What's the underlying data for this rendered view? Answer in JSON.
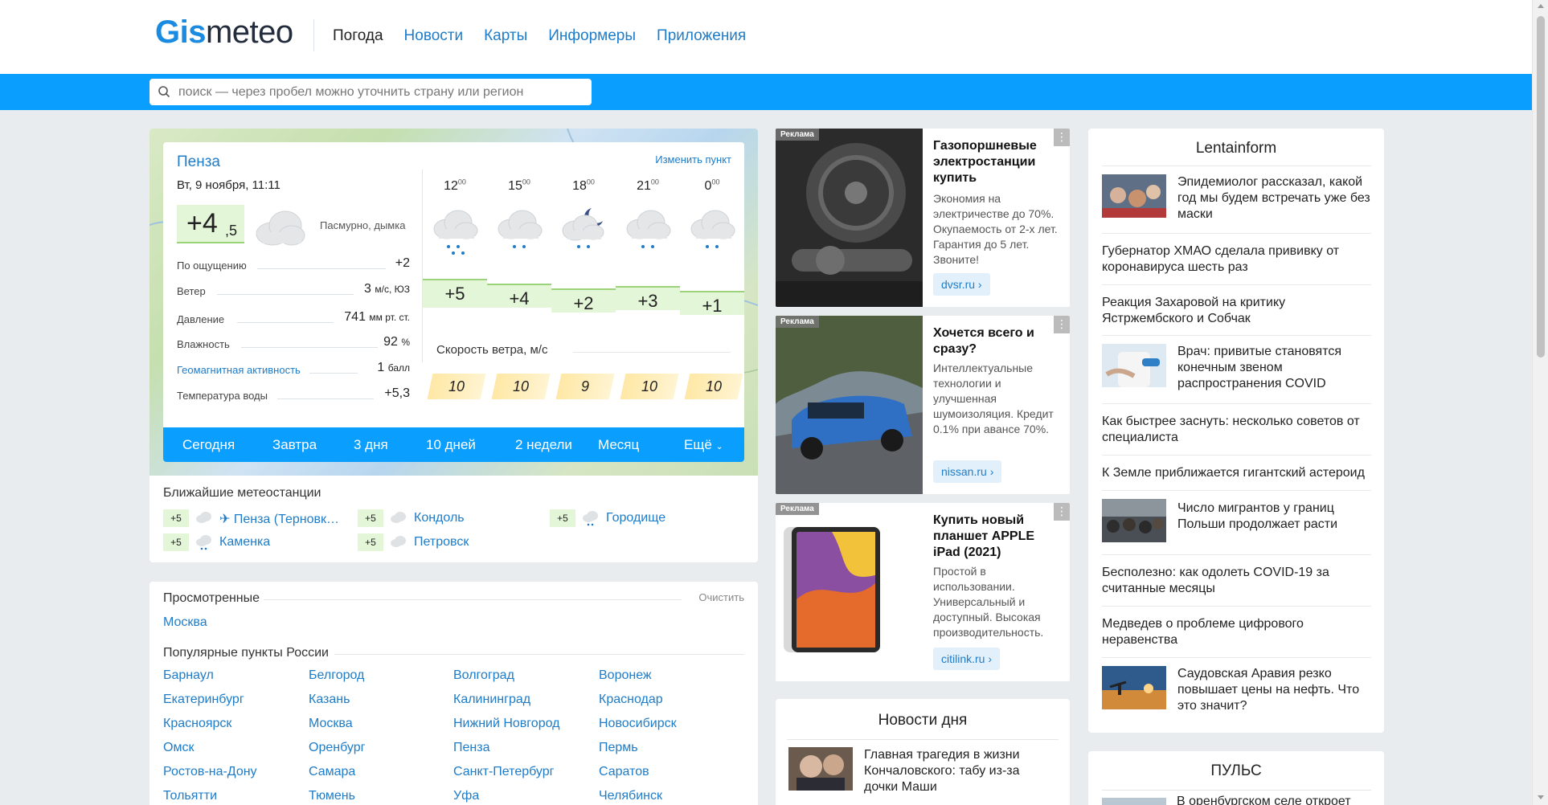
{
  "header": {
    "logo_gis": "Gis",
    "logo_meteo": "meteo",
    "nav": [
      {
        "label": "Погода",
        "active": true
      },
      {
        "label": "Новости",
        "active": false
      },
      {
        "label": "Карты",
        "active": false
      },
      {
        "label": "Информеры",
        "active": false
      },
      {
        "label": "Приложения",
        "active": false
      }
    ]
  },
  "search": {
    "placeholder": "поиск — через пробел можно уточнить страну или регион",
    "value": ""
  },
  "weather": {
    "city": "Пенза",
    "change_point": "Изменить пункт",
    "date": "Вт, 9 ноября, 11:11",
    "now_temp_main": "+4",
    "now_temp_decimal": ",5",
    "now_desc": "Пасмурно, дымка",
    "params": [
      {
        "label": "По ощущению",
        "value": "+2",
        "unit": "",
        "link": false
      },
      {
        "label": "Ветер",
        "value": "3",
        "unit": "м/с, ЮЗ",
        "link": false
      },
      {
        "label": "Давление",
        "value": "741",
        "unit": "мм рт. ст.",
        "link": false
      },
      {
        "label": "Влажность",
        "value": "92",
        "unit": "%",
        "link": false
      },
      {
        "label": "Геомагнитная активность",
        "value": "1",
        "unit": "балл",
        "link": true
      },
      {
        "label": "Температура воды",
        "value": "+5,3",
        "unit": "",
        "link": false
      }
    ],
    "forecast": [
      {
        "hour": "12",
        "min": "00",
        "temp": "+5",
        "wind": "10",
        "icon": "cloud-rain-icon"
      },
      {
        "hour": "15",
        "min": "00",
        "temp": "+4",
        "wind": "10",
        "icon": "cloud-rain-icon"
      },
      {
        "hour": "18",
        "min": "00",
        "temp": "+2",
        "wind": "9",
        "icon": "moon-cloud-rain-icon"
      },
      {
        "hour": "21",
        "min": "00",
        "temp": "+3",
        "wind": "10",
        "icon": "cloud-rain-icon"
      },
      {
        "hour": "0",
        "min": "00",
        "temp": "+1",
        "wind": "10",
        "icon": "cloud-rain-icon"
      }
    ],
    "wind_title": "Скорость ветра, м/с",
    "tabs": [
      "Сегодня",
      "Завтра",
      "3 дня",
      "10 дней",
      "2 недели",
      "Месяц",
      "Ещё"
    ],
    "stations_title": "Ближайшие метеостанции",
    "stations": [
      {
        "temp": "+5",
        "name": "✈ Пенза (Терновк…"
      },
      {
        "temp": "+5",
        "name": "Кондоль"
      },
      {
        "temp": "+5",
        "name": "Городище"
      },
      {
        "temp": "+5",
        "name": "Каменка"
      },
      {
        "temp": "+5",
        "name": "Петровск"
      }
    ]
  },
  "viewed": {
    "title": "Просмотренные",
    "clear": "Очистить",
    "cities": [
      "Москва"
    ],
    "popular_title": "Популярные пункты России",
    "popular": [
      "Барнаул",
      "Белгород",
      "Волгоград",
      "Воронеж",
      "Екатеринбург",
      "Казань",
      "Калининград",
      "Краснодар",
      "Красноярск",
      "Москва",
      "Нижний Новгород",
      "Новосибирск",
      "Омск",
      "Оренбург",
      "Пенза",
      "Пермь",
      "Ростов-на-Дону",
      "Самара",
      "Санкт-Петербург",
      "Саратов",
      "Тольятти",
      "Тюмень",
      "Уфа",
      "Челябинск"
    ]
  },
  "ads": [
    {
      "tag": "Реклама",
      "menu": "⋮",
      "head": "Газопоршневые электростанции купить",
      "body": "Экономия на электричестве до 70%. Окупаемость от 2-х лет. Гарантия до 5 лет. Звоните!",
      "domain": "dvsr.ru ›"
    },
    {
      "tag": "Реклама",
      "menu": "⋮",
      "head": "Хочется всего и сразу?",
      "body": "Интеллектуальные технологии и улучшенная шумоизоляция. Кредит 0.1% при авансе 70%.",
      "domain": "nissan.ru ›"
    },
    {
      "tag": "Реклама",
      "menu": "⋮",
      "head": "Купить новый планшет APPLE iPad (2021)",
      "body": "Простой в использовании. Универсальный и доступный. Высокая производительность.",
      "domain": "citilink.ru ›"
    }
  ],
  "news_day": {
    "title": "Новости дня",
    "items": [
      {
        "text": "Главная трагедия в жизни Кончаловского: табу из-за дочки Маши"
      }
    ]
  },
  "lenta": {
    "title": "Lentainform",
    "items": [
      {
        "text": "Эпидемиолог рассказал, какой год мы будем встречать уже без маски",
        "thumb": true
      },
      {
        "text": "Губернатор ХМАО сделала прививку от коронавируса шесть раз",
        "thumb": false
      },
      {
        "text": "Реакция Захаровой на критику Ястржембского и Собчак",
        "thumb": false
      },
      {
        "text": "Врач: привитые становятся конечным звеном распространения COVID",
        "thumb": true
      },
      {
        "text": "Как быстрее заснуть: несколько советов от специалиста",
        "thumb": false
      },
      {
        "text": "К Земле приближается гигантский астероид",
        "thumb": false
      },
      {
        "text": "Число мигрантов у границ Польши продолжает расти",
        "thumb": true
      },
      {
        "text": "Бесполезно: как одолеть COVID-19 за считанные месяцы",
        "thumb": false
      },
      {
        "text": "Медведев о проблеме цифрового неравенства",
        "thumb": false
      },
      {
        "text": "Саудовская Аравия резко повышает цены на нефть. Что это значит?",
        "thumb": true
      }
    ]
  },
  "pulse": {
    "title": "ПУЛЬС",
    "items": [
      {
        "text": "В оренбургском селе откроет"
      }
    ]
  },
  "colors": {
    "accent": "#0a9eff",
    "link": "#1e7cc8",
    "temp_bg": "#e3f6d8",
    "wind_bg": "#ffe8a6"
  }
}
